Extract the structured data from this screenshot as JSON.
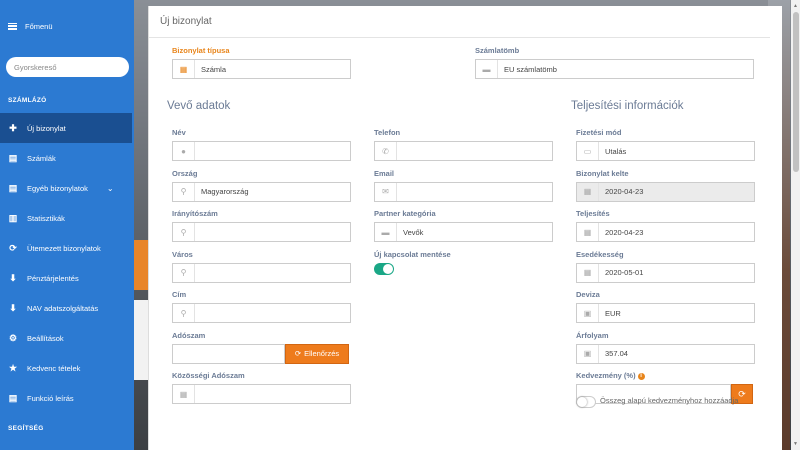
{
  "sidebar": {
    "menu_label": "Főmenü",
    "search_placeholder": "Gyorskereső",
    "section_billing": "SZÁMLÁZÓ",
    "items": [
      {
        "label": "Új bizonylat",
        "icon": "plus-icon",
        "active": true
      },
      {
        "label": "Számlák",
        "icon": "document-icon"
      },
      {
        "label": "Egyéb bizonylatok",
        "icon": "document-icon",
        "has_submenu": true
      },
      {
        "label": "Statisztikák",
        "icon": "bar-chart-icon"
      },
      {
        "label": "Ütemezett bizonylatok",
        "icon": "refresh-icon"
      },
      {
        "label": "Pénztárjelentés",
        "icon": "download-icon"
      },
      {
        "label": "NAV adatszolgáltatás",
        "icon": "download-icon"
      },
      {
        "label": "Beállítások",
        "icon": "gear-icon"
      },
      {
        "label": "Kedvenc tételek",
        "icon": "star-icon"
      },
      {
        "label": "Funkció leírás",
        "icon": "document-icon"
      }
    ],
    "section_help": "SEGÍTSÉG"
  },
  "page": {
    "title": "Új bizonylat",
    "doc_type_label": "Bizonylat típusa",
    "doc_type_value": "Számla",
    "block_label": "Számlatömb",
    "block_value": "EU számlatömb"
  },
  "buyer": {
    "heading": "Vevő adatok",
    "name_label": "Név",
    "name_value": "",
    "country_label": "Ország",
    "country_value": "Magyarország",
    "zip_label": "Irányítószám",
    "zip_value": "",
    "city_label": "Város",
    "city_value": "",
    "address_label": "Cím",
    "address_value": "",
    "tax_label": "Adószam",
    "tax_value": "",
    "check_button": "Ellenőrzés",
    "eu_tax_label": "Közösségi Adószam",
    "eu_tax_value": "",
    "phone_label": "Telefon",
    "phone_value": "",
    "email_label": "Email",
    "email_value": "",
    "partner_label": "Partner kategória",
    "partner_value": "Vevők",
    "save_contact_label": "Új kapcsolat mentése",
    "save_contact_on": true
  },
  "fulfillment": {
    "heading": "Teljesítési információk",
    "payment_label": "Fizetési mód",
    "payment_value": "Utalás",
    "issue_label": "Bizonylat kelte",
    "issue_value": "2020-04-23",
    "fulfil_label": "Teljesítés",
    "fulfil_value": "2020-04-23",
    "due_label": "Esedékesség",
    "due_value": "2020-05-01",
    "currency_label": "Deviza",
    "currency_value": "EUR",
    "rate_label": "Árfolyam",
    "rate_value": "357.04",
    "discount_label": "Kedvezmény (%)",
    "discount_value": "",
    "amount_discount_label": "Összeg alapú kedvezményhoz hozzáadja",
    "amount_discount_on": false
  },
  "colors": {
    "sidebar": "#2c7ad2",
    "sidebar_active": "#1a4f91",
    "accent": "#ee7b1c",
    "toggle_on": "#1aa786",
    "label": "#6b7b95"
  }
}
